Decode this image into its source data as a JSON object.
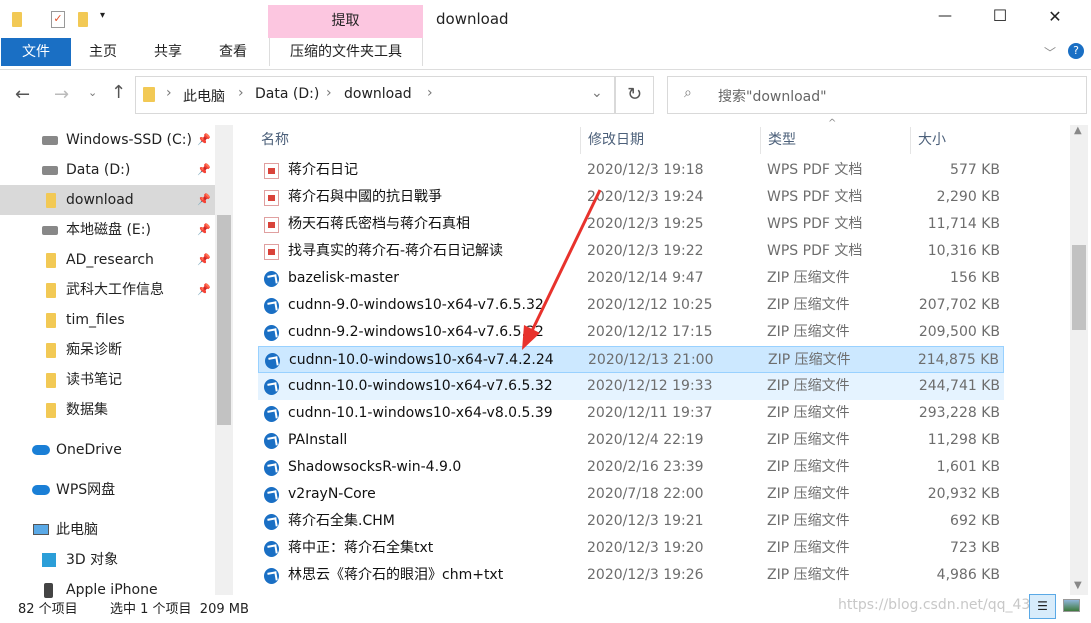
{
  "window": {
    "title": "download",
    "context_tab": "提取",
    "minimize": "—",
    "maximize": "☐",
    "close": "✕"
  },
  "ribbon": {
    "tabs": [
      "文件",
      "主页",
      "共享",
      "查看",
      "压缩的文件夹工具"
    ]
  },
  "address": {
    "crumbs": [
      "此电脑",
      "Data (D:)",
      "download"
    ]
  },
  "search": {
    "placeholder": "搜索\"download\""
  },
  "nav": [
    {
      "label": "Windows-SSD (C:)",
      "icon": "drive-icon",
      "pinned": true
    },
    {
      "label": "Data (D:)",
      "icon": "drive-icon",
      "pinned": true
    },
    {
      "label": "download",
      "icon": "folder-icon",
      "pinned": true,
      "selected": true
    },
    {
      "label": "本地磁盘 (E:)",
      "icon": "drive-icon",
      "pinned": true
    },
    {
      "label": "AD_research",
      "icon": "folder-icon",
      "pinned": true
    },
    {
      "label": "武科大工作信息",
      "icon": "folder-icon",
      "pinned": true
    },
    {
      "label": "tim_files",
      "icon": "folder-icon"
    },
    {
      "label": "痴呆诊断",
      "icon": "folder-icon"
    },
    {
      "label": "读书笔记",
      "icon": "folder-icon"
    },
    {
      "label": "数据集",
      "icon": "folder-icon"
    },
    {
      "label": "OneDrive",
      "icon": "cloud-icon"
    },
    {
      "label": "WPS网盘",
      "icon": "cloud-icon"
    },
    {
      "label": "此电脑",
      "icon": "computer-icon"
    },
    {
      "label": "3D 对象",
      "icon": "cube-icon"
    },
    {
      "label": "Apple iPhone",
      "icon": "phone-icon"
    }
  ],
  "columns": [
    "名称",
    "修改日期",
    "类型",
    "大小"
  ],
  "files": [
    {
      "name": "蒋介石日记",
      "date": "2020/12/3 19:18",
      "type": "WPS PDF 文档",
      "size": "577 KB",
      "icon": "pdf"
    },
    {
      "name": "蒋介石與中國的抗日戰爭",
      "date": "2020/12/3 19:24",
      "type": "WPS PDF 文档",
      "size": "2,290 KB",
      "icon": "pdf"
    },
    {
      "name": "杨天石蒋氏密档与蒋介石真相",
      "date": "2020/12/3 19:25",
      "type": "WPS PDF 文档",
      "size": "11,714 KB",
      "icon": "pdf"
    },
    {
      "name": "找寻真实的蒋介石-蒋介石日记解读",
      "date": "2020/12/3 19:22",
      "type": "WPS PDF 文档",
      "size": "10,316 KB",
      "icon": "pdf"
    },
    {
      "name": "bazelisk-master",
      "date": "2020/12/14 9:47",
      "type": "ZIP 压缩文件",
      "size": "156 KB",
      "icon": "zip"
    },
    {
      "name": "cudnn-9.0-windows10-x64-v7.6.5.32",
      "date": "2020/12/12 10:25",
      "type": "ZIP 压缩文件",
      "size": "207,702 KB",
      "icon": "zip"
    },
    {
      "name": "cudnn-9.2-windows10-x64-v7.6.5.32",
      "date": "2020/12/12 17:15",
      "type": "ZIP 压缩文件",
      "size": "209,500 KB",
      "icon": "zip"
    },
    {
      "name": "cudnn-10.0-windows10-x64-v7.4.2.24",
      "date": "2020/12/13 21:00",
      "type": "ZIP 压缩文件",
      "size": "214,875 KB",
      "icon": "zip",
      "selected": true
    },
    {
      "name": "cudnn-10.0-windows10-x64-v7.6.5.32",
      "date": "2020/12/12 19:33",
      "type": "ZIP 压缩文件",
      "size": "244,741 KB",
      "icon": "zip",
      "hover": true
    },
    {
      "name": "cudnn-10.1-windows10-x64-v8.0.5.39",
      "date": "2020/12/11 19:37",
      "type": "ZIP 压缩文件",
      "size": "293,228 KB",
      "icon": "zip"
    },
    {
      "name": "PAInstall",
      "date": "2020/12/4 22:19",
      "type": "ZIP 压缩文件",
      "size": "11,298 KB",
      "icon": "zip"
    },
    {
      "name": "ShadowsocksR-win-4.9.0",
      "date": "2020/2/16 23:39",
      "type": "ZIP 压缩文件",
      "size": "1,601 KB",
      "icon": "zip"
    },
    {
      "name": "v2rayN-Core",
      "date": "2020/7/18 22:00",
      "type": "ZIP 压缩文件",
      "size": "20,932 KB",
      "icon": "zip"
    },
    {
      "name": "蒋介石全集.CHM",
      "date": "2020/12/3 19:21",
      "type": "ZIP 压缩文件",
      "size": "692 KB",
      "icon": "zip"
    },
    {
      "name": "蒋中正：蒋介石全集txt",
      "date": "2020/12/3 19:20",
      "type": "ZIP 压缩文件",
      "size": "723 KB",
      "icon": "zip"
    },
    {
      "name": "林思云《蒋介石的眼泪》chm+txt",
      "date": "2020/12/3 19:26",
      "type": "ZIP 压缩文件",
      "size": "4,986 KB",
      "icon": "zip"
    }
  ],
  "status": {
    "count": "82 个项目",
    "selection": "选中 1 个项目  209 MB"
  },
  "watermark": "https://blog.csdn.net/qq_43",
  "colors": {
    "accent": "#1a6fc4",
    "context_tab": "#fcc6e0",
    "selected_row": "#cce8ff",
    "arrow": "#e8322c"
  }
}
